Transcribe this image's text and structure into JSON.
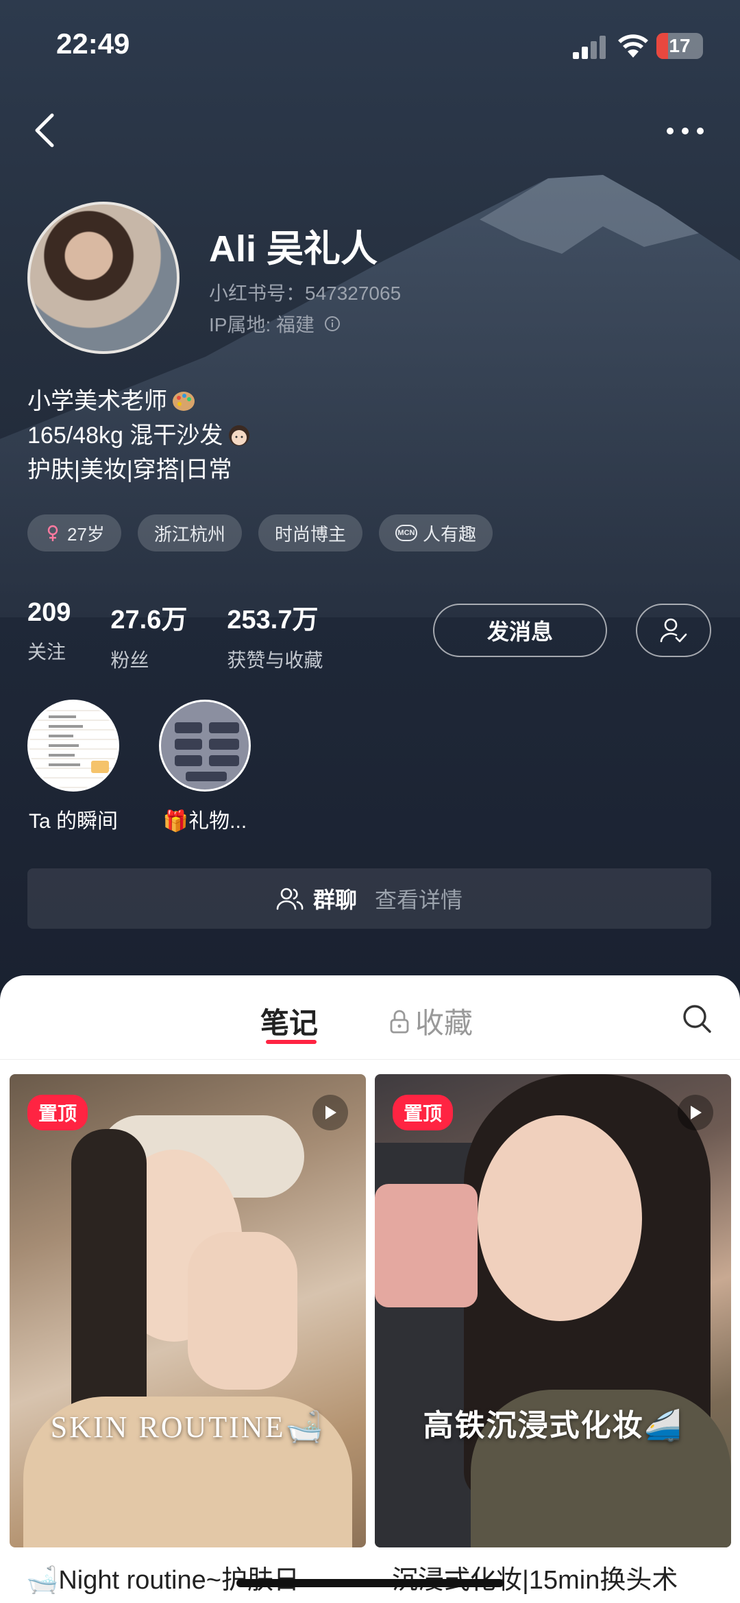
{
  "status_bar": {
    "time": "22:49",
    "battery": "17"
  },
  "profile": {
    "name": "Ali 吴礼人",
    "id_line": "小红书号：547327065",
    "ip_line": "IP属地: 福建"
  },
  "bio": [
    "小学美术老师",
    "165/48kg 混干沙发",
    "护肤|美妆|穿搭|日常"
  ],
  "tags": [
    {
      "label": "27岁",
      "icon": "female-icon"
    },
    {
      "label": "浙江杭州"
    },
    {
      "label": "时尚博主"
    },
    {
      "label": "人有趣",
      "icon": "mcn-icon",
      "badge": "MCN"
    }
  ],
  "stats": [
    {
      "value": "209",
      "label": "关注"
    },
    {
      "value": "27.6万",
      "label": "粉丝"
    },
    {
      "value": "253.7万",
      "label": "获赞与收藏"
    }
  ],
  "actions": {
    "message": "发消息"
  },
  "moments": [
    {
      "label": "Ta 的瞬间"
    },
    {
      "label": "🎁礼物..."
    }
  ],
  "group_chat": {
    "title": "群聊",
    "detail": "查看详情"
  },
  "tabs": {
    "notes": "笔记",
    "collect": "收藏"
  },
  "notes": [
    {
      "pin": "置顶",
      "caption": "SKIN ROUTINE🛁",
      "title": "🛁Night routine~护肤日"
    },
    {
      "pin": "置顶",
      "caption": "高铁沉浸式化妆🚄",
      "title": "沉浸式化妆|15min换头术"
    }
  ],
  "colors": {
    "accent": "#ff2442",
    "hero_bg": "#1f2838"
  }
}
